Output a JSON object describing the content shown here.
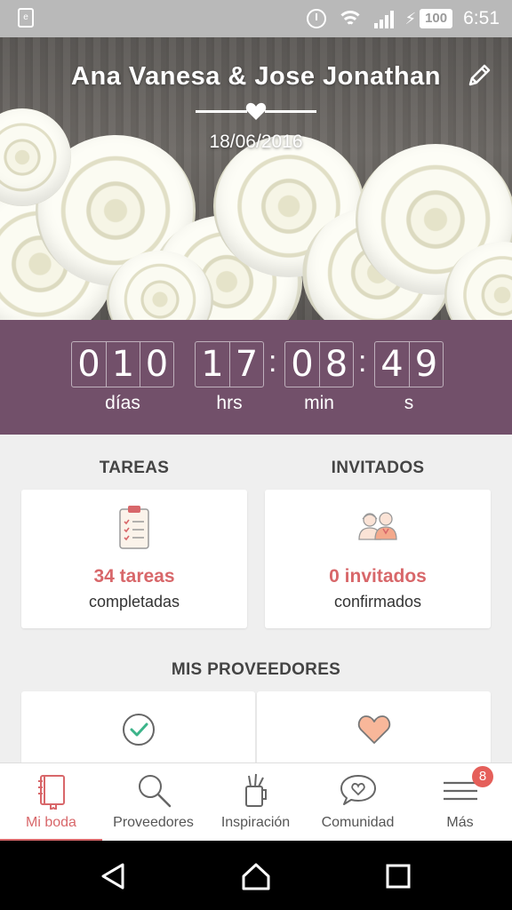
{
  "status_bar": {
    "app_icon": "e",
    "battery": "100",
    "time": "6:51",
    "icons": [
      "alarm-icon",
      "wifi-icon",
      "signal-icon",
      "charging-icon",
      "battery-icon"
    ]
  },
  "hero": {
    "title": "Ana Vanesa & Jose Jonathan",
    "date": "18/06/2016",
    "edit_icon": "pencil-icon",
    "divider_icon": "heart-icon"
  },
  "countdown": {
    "days": [
      "0",
      "1",
      "0"
    ],
    "hours": [
      "1",
      "7"
    ],
    "minutes": [
      "0",
      "8"
    ],
    "seconds": [
      "4",
      "9"
    ],
    "labels": {
      "days": "días",
      "hours": "hrs",
      "minutes": "min",
      "seconds": "s"
    }
  },
  "tasks": {
    "title": "TAREAS",
    "value": "34 tareas",
    "subtitle": "completadas",
    "icon": "clipboard-checklist-icon"
  },
  "guests": {
    "title": "INVITADOS",
    "value": "0 invitados",
    "subtitle": "confirmados",
    "icon": "couple-icon"
  },
  "vendors": {
    "title": "MIS PROVEEDORES",
    "icons": [
      "check-circle-icon",
      "heart-icon"
    ]
  },
  "bottom_nav": {
    "items": [
      {
        "label": "Mi boda",
        "icon": "notebook-icon",
        "active": true
      },
      {
        "label": "Proveedores",
        "icon": "search-icon",
        "active": false
      },
      {
        "label": "Inspiración",
        "icon": "inspiration-cup-icon",
        "active": false
      },
      {
        "label": "Comunidad",
        "icon": "chat-heart-icon",
        "active": false
      },
      {
        "label": "Más",
        "icon": "menu-icon",
        "active": false,
        "badge": "8"
      }
    ]
  },
  "colors": {
    "accent": "#d8676a",
    "countdown_bg": "#72506a",
    "status_bar": "#b9b9b9",
    "badge": "#e55f5a"
  }
}
